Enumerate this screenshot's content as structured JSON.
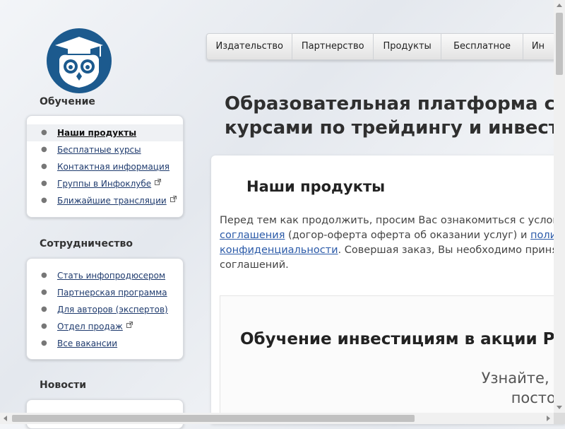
{
  "logo": {
    "icon": "owl-graduation-cap-logo",
    "color": "#1c5a8e"
  },
  "sidebar": {
    "sections": [
      {
        "title": "Обучение",
        "items": [
          {
            "label": "Наши продукты",
            "active": true,
            "external": false
          },
          {
            "label": "Бесплатные курсы",
            "external": false
          },
          {
            "label": "Контактная информация",
            "external": false
          },
          {
            "label": "Группы в Инфоклубе",
            "external": true
          },
          {
            "label": "Ближайшие трансляции",
            "external": true
          }
        ]
      },
      {
        "title": "Сотрудничество",
        "items": [
          {
            "label": "Стать инфопродюсером",
            "external": false
          },
          {
            "label": "Партнерская программа",
            "external": false
          },
          {
            "label": "Для авторов (экспертов)",
            "external": false
          },
          {
            "label": "Отдел продаж",
            "external": true
          },
          {
            "label": "Все вакансии",
            "external": false
          }
        ]
      },
      {
        "title": "Новости",
        "items": []
      }
    ]
  },
  "topnav": {
    "items": [
      "Издательство",
      "Партнерство",
      "Продукты",
      "Бесплатное",
      "Ин"
    ]
  },
  "page": {
    "heading_line1": "Образовательная платформа с",
    "heading_line2": "курсами по трейдингу и инвести"
  },
  "content": {
    "title": "Наши продукты",
    "notice": {
      "text1": "Перед тем как продолжить, просим Вас ознакомиться с услови",
      "link1": "соглашения",
      "text2": " (догор-оферта оферта об оказании услуг) и ",
      "link2a": "полити",
      "link2b": "конфиденциальности",
      "text3": ". Совершая заказ, Вы необходимо принят",
      "text4": "соглашений."
    },
    "card": {
      "title": "Обучение инвестициям в акции РС",
      "sub1": "Узнайте, к",
      "sub2": "постоянн"
    }
  },
  "colors": {
    "link": "#2b5aa8",
    "nav_gradient_top": "#fafafa",
    "nav_gradient_bottom": "#e3e3e3"
  }
}
